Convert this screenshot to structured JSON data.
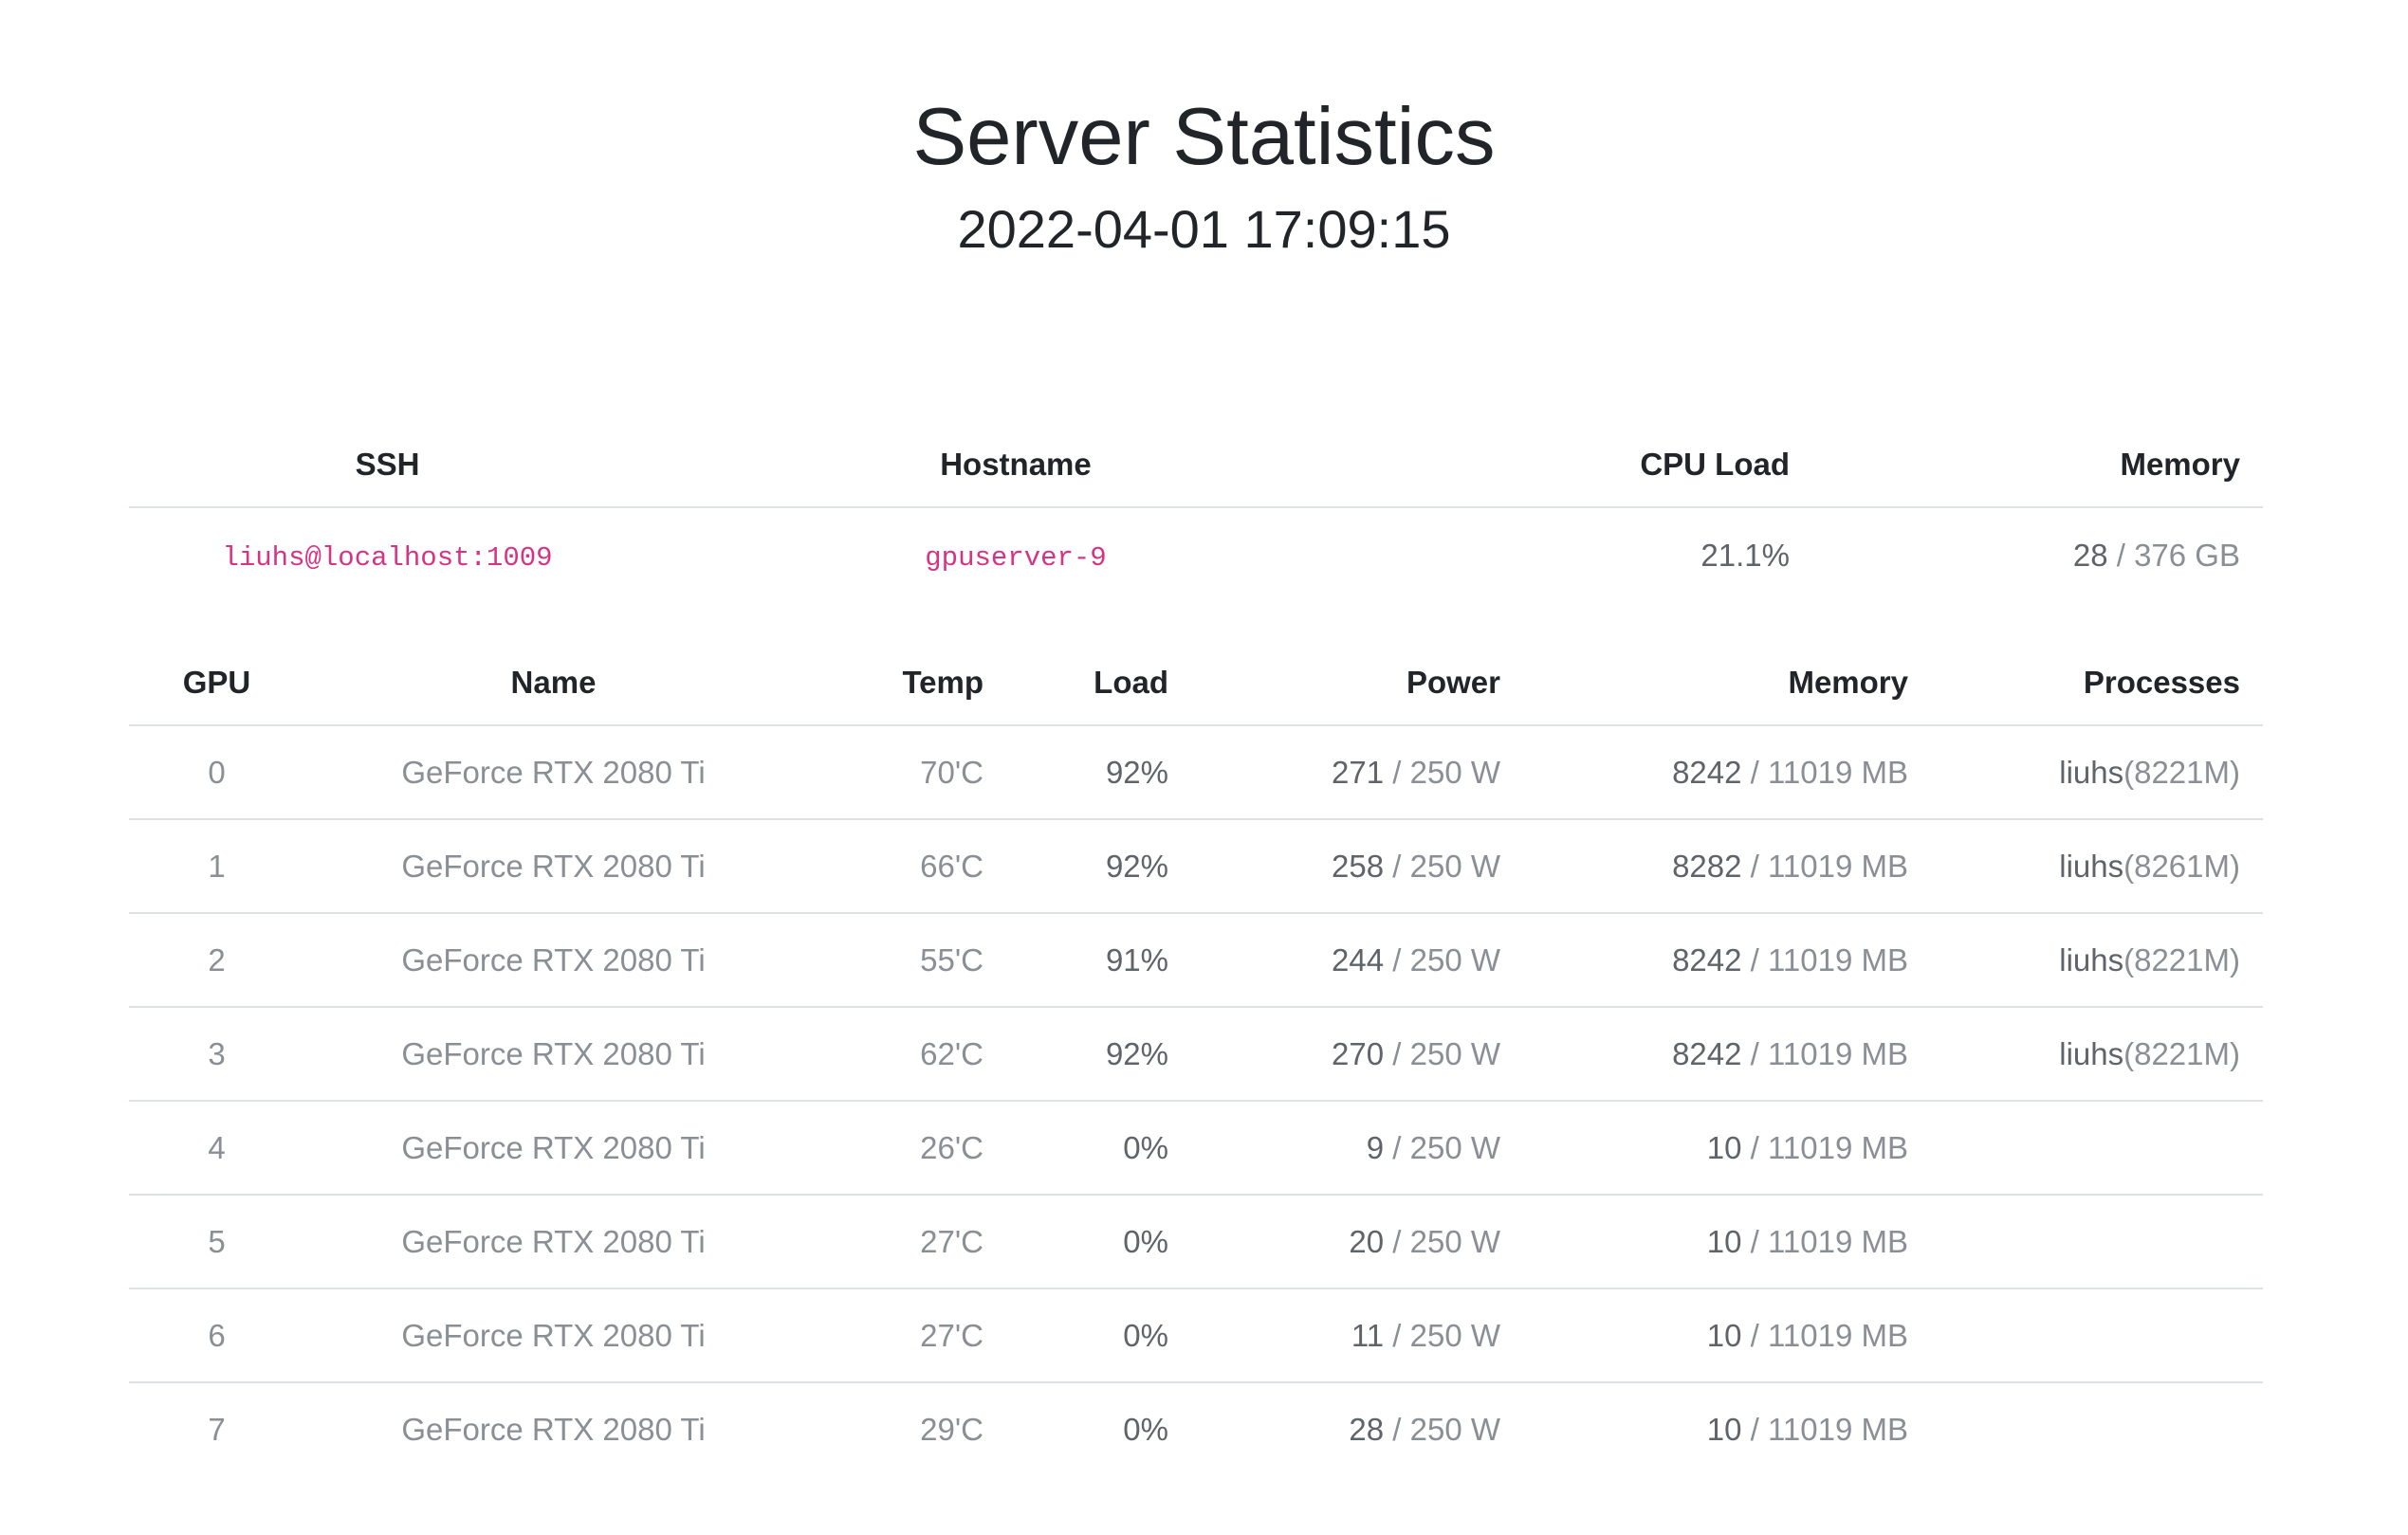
{
  "page": {
    "title": "Server Statistics",
    "timestamp": "2022-04-01 17:09:15"
  },
  "server_table": {
    "headers": {
      "ssh": "SSH",
      "hostname": "Hostname",
      "cpu_load": "CPU Load",
      "memory": "Memory"
    },
    "row": {
      "ssh": "liuhs@localhost:1009",
      "hostname": "gpuserver-9",
      "cpu_load": "21.1%",
      "memory_used": "28",
      "memory_total": " / 376 GB"
    }
  },
  "gpu_table": {
    "headers": {
      "gpu": "GPU",
      "name": "Name",
      "temp": "Temp",
      "load": "Load",
      "power": "Power",
      "memory": "Memory",
      "processes": "Processes"
    },
    "rows": [
      {
        "gpu": "0",
        "name": "GeForce RTX 2080 Ti",
        "temp": "70'C",
        "load": "92%",
        "power_used": "271",
        "power_cap": " / 250 W",
        "mem_used": "8242",
        "mem_total": " / 11019 MB",
        "proc_user": "liuhs",
        "proc_mem": "(8221M)"
      },
      {
        "gpu": "1",
        "name": "GeForce RTX 2080 Ti",
        "temp": "66'C",
        "load": "92%",
        "power_used": "258",
        "power_cap": " / 250 W",
        "mem_used": "8282",
        "mem_total": " / 11019 MB",
        "proc_user": "liuhs",
        "proc_mem": "(8261M)"
      },
      {
        "gpu": "2",
        "name": "GeForce RTX 2080 Ti",
        "temp": "55'C",
        "load": "91%",
        "power_used": "244",
        "power_cap": " / 250 W",
        "mem_used": "8242",
        "mem_total": " / 11019 MB",
        "proc_user": "liuhs",
        "proc_mem": "(8221M)"
      },
      {
        "gpu": "3",
        "name": "GeForce RTX 2080 Ti",
        "temp": "62'C",
        "load": "92%",
        "power_used": "270",
        "power_cap": " / 250 W",
        "mem_used": "8242",
        "mem_total": " / 11019 MB",
        "proc_user": "liuhs",
        "proc_mem": "(8221M)"
      },
      {
        "gpu": "4",
        "name": "GeForce RTX 2080 Ti",
        "temp": "26'C",
        "load": "0%",
        "power_used": "9",
        "power_cap": " / 250 W",
        "mem_used": "10",
        "mem_total": " / 11019 MB",
        "proc_user": "",
        "proc_mem": ""
      },
      {
        "gpu": "5",
        "name": "GeForce RTX 2080 Ti",
        "temp": "27'C",
        "load": "0%",
        "power_used": "20",
        "power_cap": " / 250 W",
        "mem_used": "10",
        "mem_total": " / 11019 MB",
        "proc_user": "",
        "proc_mem": ""
      },
      {
        "gpu": "6",
        "name": "GeForce RTX 2080 Ti",
        "temp": "27'C",
        "load": "0%",
        "power_used": "11",
        "power_cap": " / 250 W",
        "mem_used": "10",
        "mem_total": " / 11019 MB",
        "proc_user": "",
        "proc_mem": ""
      },
      {
        "gpu": "7",
        "name": "GeForce RTX 2080 Ti",
        "temp": "29'C",
        "load": "0%",
        "power_used": "28",
        "power_cap": " / 250 W",
        "mem_used": "10",
        "mem_total": " / 11019 MB",
        "proc_user": "",
        "proc_mem": ""
      }
    ]
  }
}
